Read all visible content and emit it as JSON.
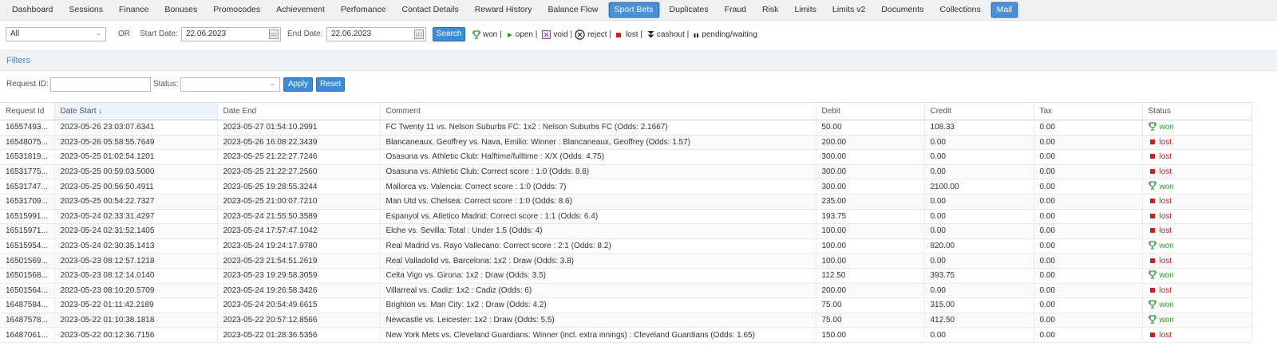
{
  "nav": {
    "tabs": [
      "Dashboard",
      "Sessions",
      "Finance",
      "Bonuses",
      "Promocodes",
      "Achievement",
      "Perfomance",
      "Contact Details",
      "Reward History",
      "Balance Flow",
      "Sport Bets",
      "Duplicates",
      "Fraud",
      "Risk",
      "Limits",
      "Limits v2",
      "Documents",
      "Collections",
      "Mail"
    ],
    "active": [
      "Sport Bets",
      "Mail"
    ]
  },
  "search": {
    "type_select": "All",
    "or_label": "OR",
    "start_date_label": "Start Date:",
    "start_date": "22.06.2023",
    "end_date_label": "End Date:",
    "end_date": "22.06.2023",
    "search_button": "Search",
    "legend": [
      {
        "icon": "trophy-icon",
        "text": "won |"
      },
      {
        "icon": "play-icon",
        "text": "open |"
      },
      {
        "icon": "void-box-icon",
        "text": "void |"
      },
      {
        "icon": "reject-circle-icon",
        "text": "reject |"
      },
      {
        "icon": "lost-square-icon",
        "text": "lost |"
      },
      {
        "icon": "cashout-arrows-icon",
        "text": "cashout |"
      },
      {
        "icon": "pause-icon",
        "text": "pending/waiting"
      }
    ]
  },
  "filters": {
    "title": "Filters",
    "request_id_label": "Request ID:",
    "status_label": "Status:",
    "apply_button": "Apply",
    "reset_button": "Reset"
  },
  "table": {
    "columns": [
      "Request Id",
      "Date Start ↓",
      "Date End",
      "Comment",
      "Debit",
      "Credit",
      "Tax",
      "Status"
    ],
    "rows": [
      [
        "16557493...",
        "2023-05-26 23:03:07.6341",
        "2023-05-27 01:54:10.2991",
        "FC Twenty 11 vs. Nelson Suburbs FC: 1x2 : Nelson Suburbs FC (Odds: 2.1667)",
        "50.00",
        "108.33",
        "0.00",
        "won"
      ],
      [
        "16548075...",
        "2023-05-26 05:58:55.7649",
        "2023-05-26 16:08:22.3439",
        "Blancaneaux, Geoffrey vs. Nava, Emilio: Winner : Blancaneaux, Geoffrey (Odds: 1.57)",
        "200.00",
        "0.00",
        "0.00",
        "lost"
      ],
      [
        "16531819...",
        "2023-05-25 01:02:54.1201",
        "2023-05-25 21:22:27.7246",
        "Osasuna vs. Athletic Club: Halftime/fulltime : X/X (Odds: 4.75)",
        "300.00",
        "0.00",
        "0.00",
        "lost"
      ],
      [
        "16531775...",
        "2023-05-25 00:59:03.5000",
        "2023-05-25 21:22:27.2560",
        "Osasuna vs. Athletic Club: Correct score : 1:0 (Odds: 8.8)",
        "300.00",
        "0.00",
        "0.00",
        "lost"
      ],
      [
        "16531747...",
        "2023-05-25 00:56:50.4911",
        "2023-05-25 19:28:55.3244",
        "Mallorca vs. Valencia: Correct score : 1:0 (Odds: 7)",
        "300.00",
        "2100.00",
        "0.00",
        "won"
      ],
      [
        "16531709...",
        "2023-05-25 00:54:22.7327",
        "2023-05-25 21:00:07.7210",
        "Man Utd vs. Chelsea: Correct score : 1:0 (Odds: 8.6)",
        "235.00",
        "0.00",
        "0.00",
        "lost"
      ],
      [
        "16515991...",
        "2023-05-24 02:33:31.4297",
        "2023-05-24 21:55:50.3589",
        "Espanyol vs. Atletico Madrid: Correct score : 1:1 (Odds: 6.4)",
        "193.75",
        "0.00",
        "0.00",
        "lost"
      ],
      [
        "16515971...",
        "2023-05-24 02:31:52.1405",
        "2023-05-24 17:57:47.1042",
        "Elche vs. Sevilla: Total : Under 1.5 (Odds: 4)",
        "100.00",
        "0.00",
        "0.00",
        "lost"
      ],
      [
        "16515954...",
        "2023-05-24 02:30:35.1413",
        "2023-05-24 19:24:17.9780",
        "Real Madrid vs. Rayo Vallecano: Correct score : 2:1 (Odds: 8.2)",
        "100.00",
        "820.00",
        "0.00",
        "won"
      ],
      [
        "16501569...",
        "2023-05-23 08:12:57.1218",
        "2023-05-23 21:54:51.2619",
        "Real Valladolid vs. Barcelona: 1x2 : Draw (Odds: 3.8)",
        "100.00",
        "0.00",
        "0.00",
        "lost"
      ],
      [
        "16501568...",
        "2023-05-23 08:12:14.0140",
        "2023-05-23 19:29:58.3059",
        "Celta Vigo vs. Girona: 1x2 : Draw (Odds: 3.5)",
        "112.50",
        "393.75",
        "0.00",
        "won"
      ],
      [
        "16501564...",
        "2023-05-23 08:10:20.5709",
        "2023-05-24 19:26:58.3426",
        "Villarreal vs. Cadiz: 1x2 : Cadiz (Odds: 6)",
        "200.00",
        "0.00",
        "0.00",
        "lost"
      ],
      [
        "16487584...",
        "2023-05-22 01:11:42.2189",
        "2023-05-24 20:54:49.6615",
        "Brighton vs. Man City: 1x2 : Draw (Odds: 4.2)",
        "75.00",
        "315.00",
        "0.00",
        "won"
      ],
      [
        "16487578...",
        "2023-05-22 01:10:38.1818",
        "2023-05-22 20:57:12.8566",
        "Newcastle vs. Leicester: 1x2 : Draw (Odds: 5.5)",
        "75.00",
        "412.50",
        "0.00",
        "won"
      ],
      [
        "16487061...",
        "2023-05-22 00:12:36.7156",
        "2023-05-22 01:28:36.5356",
        "New York Mets vs. Cleveland Guardians: Winner (incl. extra innings) : Cleveland Guardians (Odds: 1.65)",
        "150.00",
        "0.00",
        "0.00",
        "lost"
      ]
    ]
  },
  "colors": {
    "accent": "#3a8bd9",
    "won": "#2a9a2a",
    "lost": "#d01a1a",
    "link": "#3b86d6"
  }
}
